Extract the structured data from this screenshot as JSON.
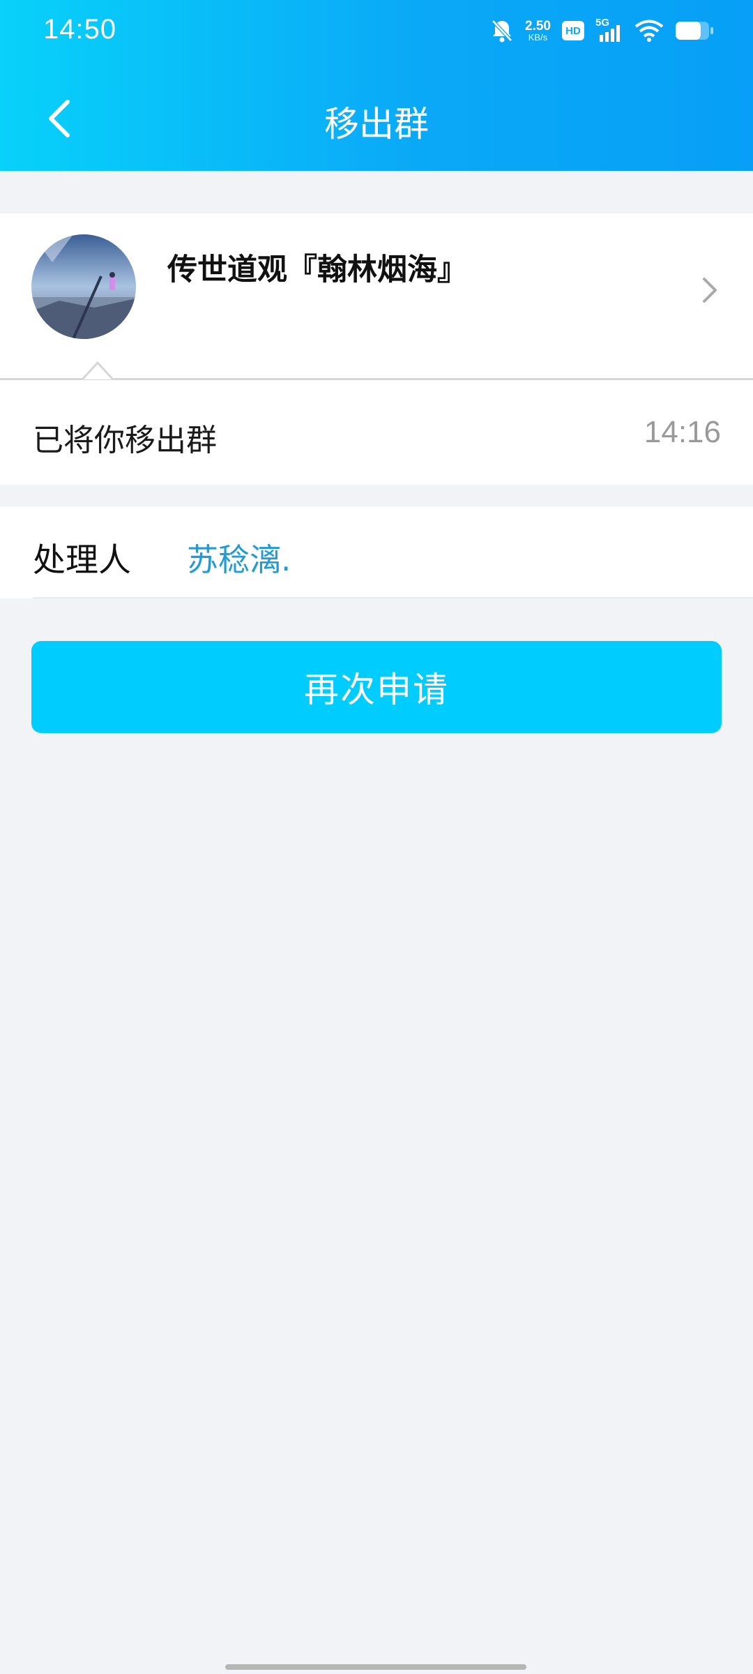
{
  "status_bar": {
    "time": "14:50",
    "net_speed_value": "2.50",
    "net_speed_unit": "KB/s",
    "hd_label": "HD",
    "network_label": "5G",
    "icons": [
      "mute-bell-icon",
      "hd-icon",
      "5g-signal-icon",
      "wifi-icon",
      "battery-icon"
    ]
  },
  "nav": {
    "title": "移出群",
    "back_icon": "chevron-left-icon"
  },
  "group": {
    "name": "传世道观『翰林烟海』",
    "chevron_icon": "chevron-right-icon"
  },
  "message": {
    "text": "已将你移出群",
    "time": "14:16"
  },
  "handler": {
    "label": "处理人",
    "name": "苏稔漓."
  },
  "actions": {
    "reapply_label": "再次申请"
  },
  "colors": {
    "header_gradient_start": "#08d1fa",
    "header_gradient_end": "#079ff7",
    "button": "#00cdfd",
    "handler_link": "#1f9bd8",
    "background": "#f2f3f7"
  }
}
